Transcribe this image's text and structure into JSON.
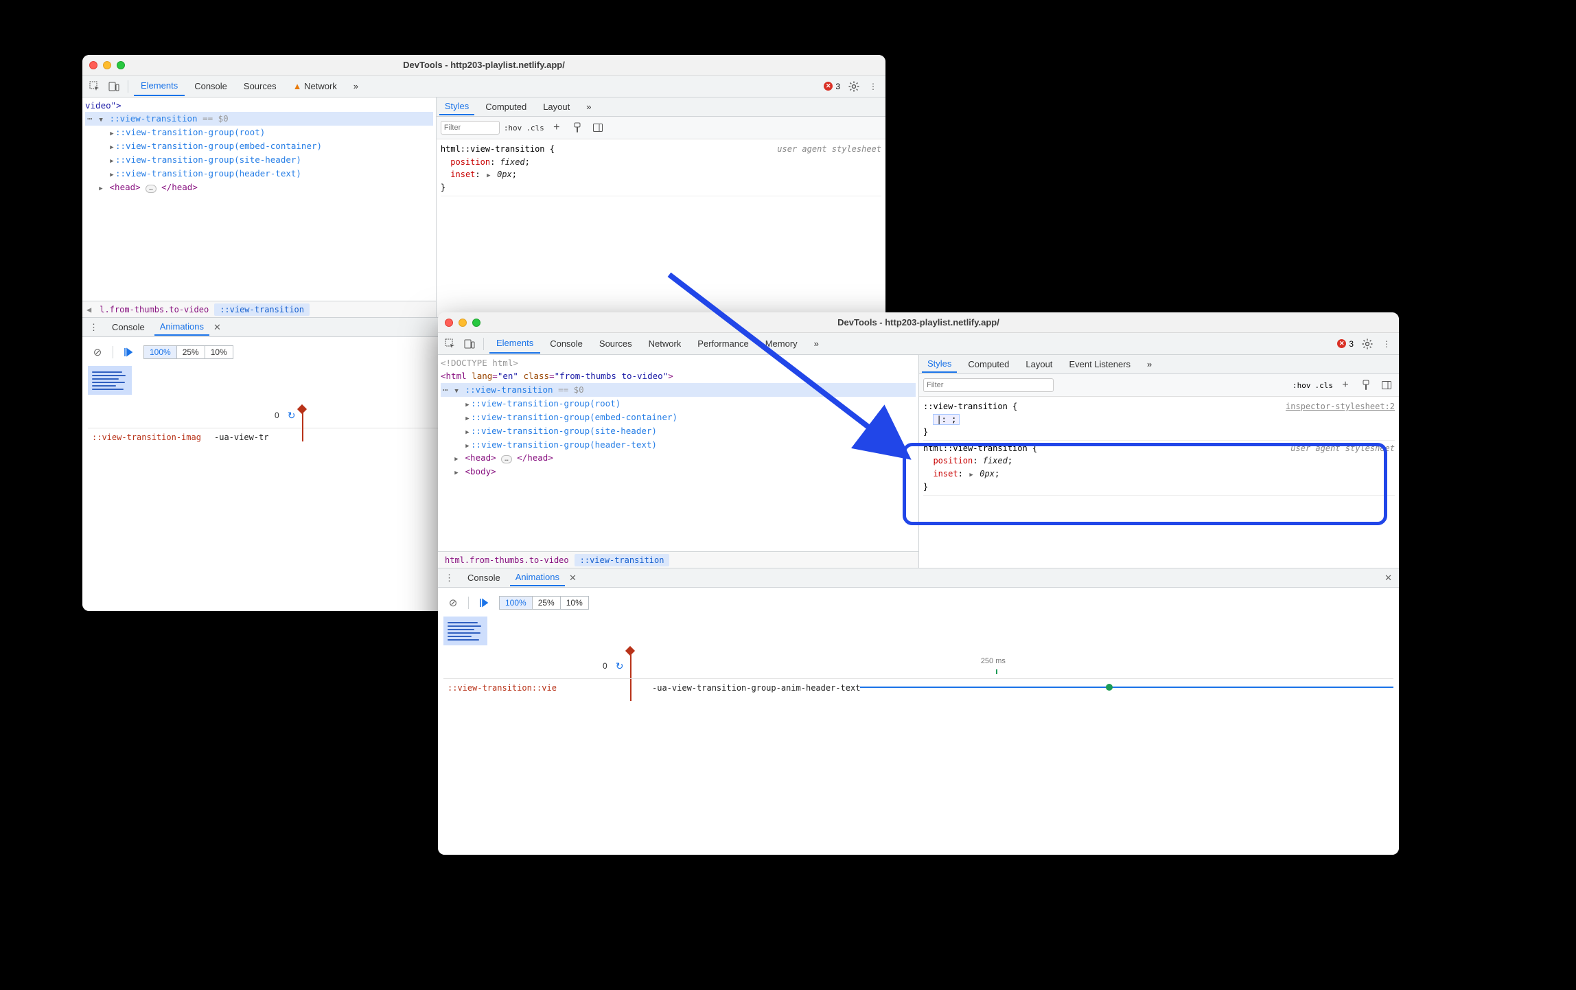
{
  "bg": "#000",
  "window1": {
    "title": "DevTools - http203-playlist.netlify.app/",
    "tabs": {
      "elements": "Elements",
      "console": "Console",
      "sources": "Sources",
      "network": "Network",
      "more": "»"
    },
    "errCount": "3",
    "dom": {
      "videoEnd": "video\">",
      "viewTransition": "::view-transition",
      "vtDim": "== $0",
      "groups": [
        "::view-transition-group(root)",
        "::view-transition-group(embed-container)",
        "::view-transition-group(site-header)",
        "::view-transition-group(header-text)"
      ],
      "headOpen": "<head>",
      "headClose": "</head>",
      "ellipsis": "…"
    },
    "crumbs": {
      "left": "l.from-thumbs.to-video",
      "right": "::view-transition"
    },
    "styles": {
      "tab_styles": "Styles",
      "tab_computed": "Computed",
      "tab_layout": "Layout",
      "more": "»",
      "filter_ph": "Filter",
      "hov": ":hov",
      "cls": ".cls",
      "rule_selector": "html::view-transition {",
      "ua_note": "user agent stylesheet",
      "prop1": "position",
      "val1": "fixed",
      "prop2": "inset",
      "val2": "0px",
      "close": "}"
    },
    "drawer": {
      "console": "Console",
      "animations": "Animations",
      "rates": {
        "r100": "100%",
        "r25": "25%",
        "r10": "10%"
      },
      "zero": "0",
      "anim_selector": "::view-transition-imag",
      "anim_name": "-ua-view-tr"
    }
  },
  "window2": {
    "title": "DevTools - http203-playlist.netlify.app/",
    "tabs": {
      "elements": "Elements",
      "console": "Console",
      "sources": "Sources",
      "network": "Network",
      "performance": "Performance",
      "memory": "Memory",
      "more": "»"
    },
    "errCount": "3",
    "dom": {
      "doctype": "<!DOCTYPE html>",
      "htmlOpen": "<html lang=\"en\" class=\"from-thumbs to-video\">",
      "viewTransition": "::view-transition",
      "vtDim": "== $0",
      "groups": [
        "::view-transition-group(root)",
        "::view-transition-group(embed-container)",
        "::view-transition-group(site-header)",
        "::view-transition-group(header-text)"
      ],
      "headOpen": "<head>",
      "headClose": "</head>",
      "bodyOpen": "<body>",
      "ellipsis": "…"
    },
    "crumbs": {
      "left": "html.from-thumbs.to-video",
      "right": "::view-transition"
    },
    "styles": {
      "tab_styles": "Styles",
      "tab_computed": "Computed",
      "tab_layout": "Layout",
      "tab_listeners": "Event Listeners",
      "more": "»",
      "filter_ph": "Filter",
      "hov": ":hov",
      "cls": ".cls",
      "ruleA_selector": "::view-transition {",
      "ruleA_src": "inspector-stylesheet:2",
      "ruleA_body": "|:  ;",
      "ruleA_close": "}",
      "ruleB_selector": "html::view-transition {",
      "ua_note": "user agent stylesheet",
      "prop1": "position",
      "val1": "fixed",
      "prop2": "inset",
      "val2": "0px",
      "close": "}"
    },
    "drawer": {
      "console": "Console",
      "animations": "Animations",
      "rates": {
        "r100": "100%",
        "r25": "25%",
        "r10": "10%"
      },
      "zero": "0",
      "ms250": "250 ms",
      "anim_selector": "::view-transition::vie",
      "anim_name": "-ua-view-transition-group-anim-header-text"
    }
  }
}
